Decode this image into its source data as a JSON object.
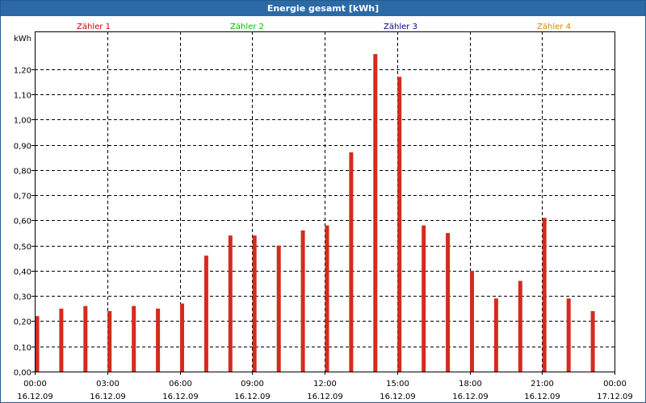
{
  "window": {
    "title": "Energie gesamt [kWh]"
  },
  "chart_data": {
    "type": "bar",
    "title": "Energie gesamt [kWh]",
    "ylabel": "kWh",
    "ylim": [
      0,
      1.35
    ],
    "yticks": [
      0,
      0.1,
      0.2,
      0.3,
      0.4,
      0.5,
      0.6,
      0.7,
      0.8,
      0.9,
      1.0,
      1.1,
      1.2
    ],
    "ytick_labels": [
      "0,00",
      "0,10",
      "0,20",
      "0,30",
      "0,40",
      "0,50",
      "0,60",
      "0,70",
      "0,80",
      "0,90",
      "1,00",
      "1,10",
      "1,20"
    ],
    "xlim": [
      0,
      24
    ],
    "xticks": [
      {
        "hour": 0,
        "time": "00:00",
        "date": "16.12.09"
      },
      {
        "hour": 3,
        "time": "03:00",
        "date": "16.12.09"
      },
      {
        "hour": 6,
        "time": "06:00",
        "date": "16.12.09"
      },
      {
        "hour": 9,
        "time": "09:00",
        "date": "16.12.09"
      },
      {
        "hour": 12,
        "time": "12:00",
        "date": "16.12.09"
      },
      {
        "hour": 15,
        "time": "15:00",
        "date": "16.12.09"
      },
      {
        "hour": 18,
        "time": "18:00",
        "date": "16.12.09"
      },
      {
        "hour": 21,
        "time": "21:00",
        "date": "16.12.09"
      },
      {
        "hour": 24,
        "time": "00:00",
        "date": "17.12.09"
      }
    ],
    "grid": true,
    "legend": [
      {
        "name": "Zähler 1",
        "color": "#cc0000"
      },
      {
        "name": "Zähler 2",
        "color": "#00bb00"
      },
      {
        "name": "Zähler 3",
        "color": "#000099"
      },
      {
        "name": "Zähler 4",
        "color": "#cc8800"
      }
    ],
    "series": [
      {
        "name": "Zähler 1",
        "color": "#d42b1e",
        "x": [
          0,
          1,
          2,
          3,
          4,
          5,
          6,
          7,
          8,
          9,
          10,
          11,
          12,
          13,
          14,
          15,
          16,
          17,
          18,
          19,
          20,
          21,
          22,
          23
        ],
        "values": [
          0.22,
          0.25,
          0.26,
          0.24,
          0.26,
          0.25,
          0.27,
          0.46,
          0.54,
          0.54,
          0.5,
          0.56,
          0.58,
          0.87,
          1.26,
          1.17,
          0.58,
          0.55,
          0.4,
          0.29,
          0.36,
          0.61,
          0.29,
          0.24
        ]
      }
    ]
  }
}
